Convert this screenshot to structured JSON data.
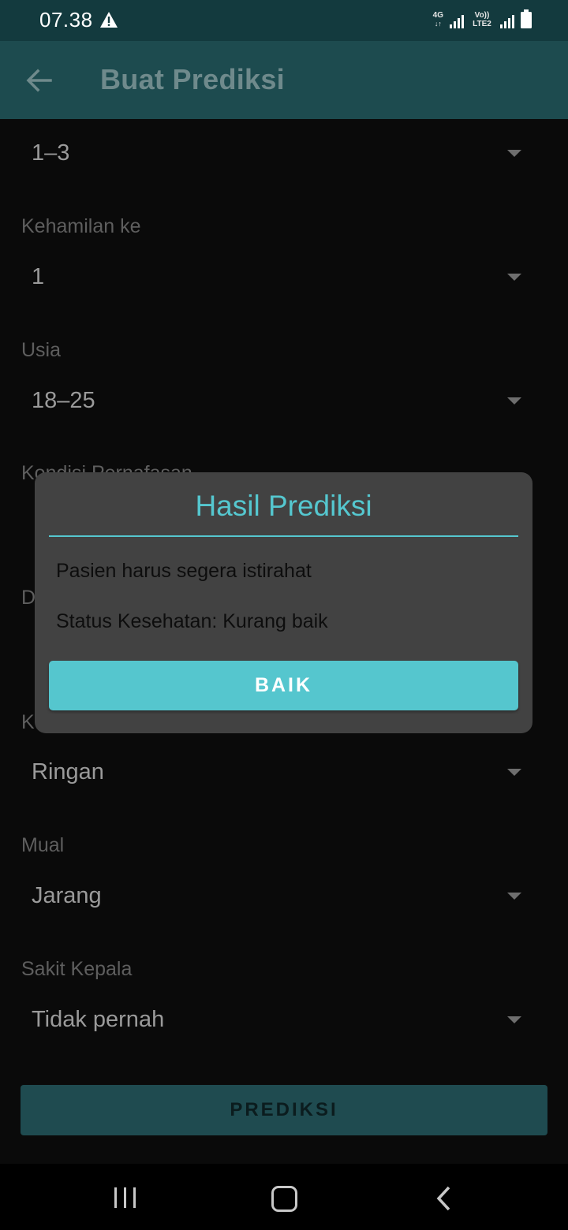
{
  "status_bar": {
    "time": "07.38",
    "network_label": "4G",
    "volte_label": "Vo)) LTE2",
    "icons": [
      "alert-triangle-icon",
      "signal-icon",
      "signal-icon",
      "battery-icon"
    ]
  },
  "app_bar": {
    "back_icon": "arrow-left-icon",
    "title": "Buat Prediksi"
  },
  "form": {
    "first_value": "1–3",
    "fields": [
      {
        "label": "Kehamilan ke",
        "value": "1"
      },
      {
        "label": "Usia",
        "value": "18–25"
      },
      {
        "label": "Kondisi Pernafasan",
        "value": ""
      },
      {
        "label": "D",
        "value": ""
      },
      {
        "label": "K",
        "value": "Ringan"
      },
      {
        "label": "Mual",
        "value": "Jarang"
      },
      {
        "label": "Sakit Kepala",
        "value": "Tidak pernah"
      }
    ],
    "predict_button": "PREDIKSI"
  },
  "dialog": {
    "title": "Hasil Prediksi",
    "message_line_1": "Pasien harus segera istirahat",
    "message_line_2": "Status Kesehatan: Kurang baik",
    "button": "BAIK"
  },
  "nav_bar": {
    "icons": [
      "recent-apps-icon",
      "home-icon",
      "back-icon"
    ]
  },
  "colors": {
    "accent": "#55c6ce",
    "app_bar": "#1d4b4f",
    "status_bar": "#133a3e",
    "dialog_bg": "#424242"
  }
}
